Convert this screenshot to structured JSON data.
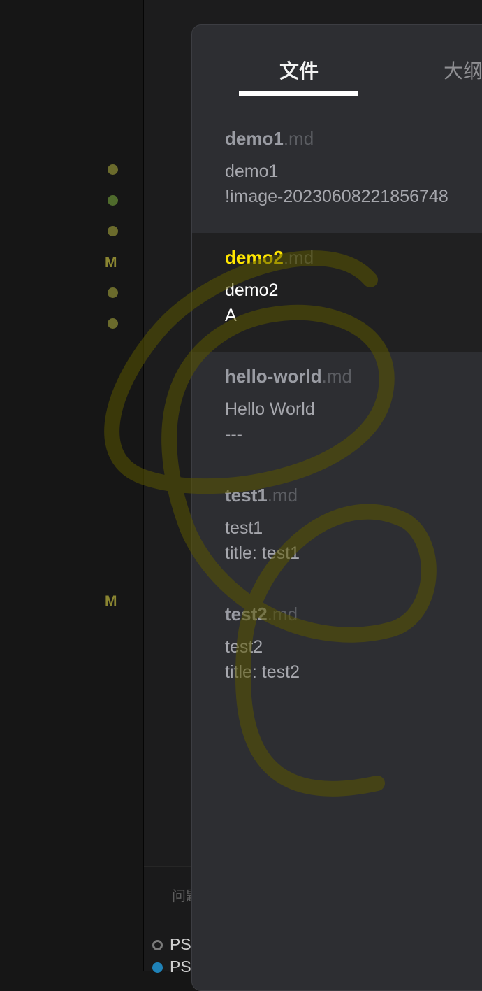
{
  "gutter": {
    "dot_colors": [
      "#6b6b2c",
      "#4f6b2c",
      "#6b6b2c",
      "#6b6b2c",
      "#6b6b2c"
    ],
    "modified_marker": "M"
  },
  "bottom_panel": {
    "tab_label": "问题",
    "terminals": [
      {
        "label": "PS",
        "status": "inactive"
      },
      {
        "label": "PS",
        "status": "active"
      }
    ]
  },
  "popup": {
    "tabs": [
      {
        "label": "文件",
        "active": true
      },
      {
        "label": "大纲",
        "active": false
      }
    ],
    "files": [
      {
        "name": "demo1",
        "ext": ".md",
        "line1": "demo1",
        "line2": "!image-20230608221856748",
        "active": false
      },
      {
        "name": "demo2",
        "ext": ".md",
        "line1": "demo2",
        "line2": "A",
        "active": true
      },
      {
        "name": "hello-world",
        "ext": ".md",
        "line1": "Hello World",
        "line2": "---",
        "active": false
      },
      {
        "name": "test1",
        "ext": ".md",
        "line1": "test1",
        "line2": "title: test1",
        "active": false
      },
      {
        "name": "test2",
        "ext": ".md",
        "line1": "test2",
        "line2": "title: test2",
        "active": false
      }
    ]
  },
  "colors": {
    "highlight": "#ffe600",
    "scribble": "#4d4a00"
  }
}
